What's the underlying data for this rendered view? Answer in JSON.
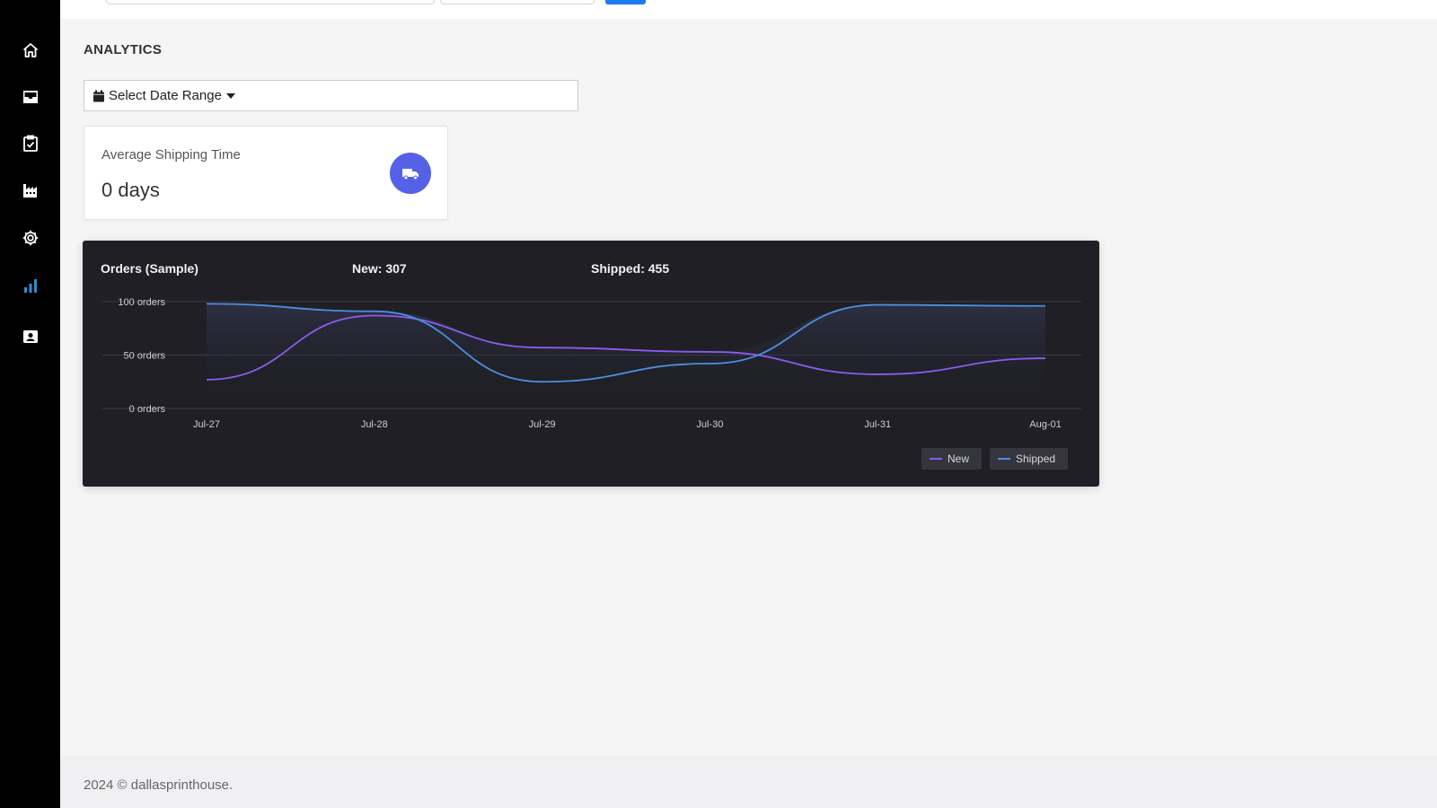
{
  "sidebar": {
    "items": [
      {
        "icon": "home-icon",
        "label": "Home",
        "active": false
      },
      {
        "icon": "inbox-icon",
        "label": "Inbox",
        "active": false
      },
      {
        "icon": "clipboard-check-icon",
        "label": "Tasks",
        "active": false
      },
      {
        "icon": "factory-icon",
        "label": "Production",
        "active": false
      },
      {
        "icon": "gear-icon",
        "label": "Settings",
        "active": false
      },
      {
        "icon": "bar-chart-icon",
        "label": "Analytics",
        "active": true
      },
      {
        "icon": "id-card-icon",
        "label": "Contacts",
        "active": false
      }
    ],
    "active_color": "#2a8fd6"
  },
  "page": {
    "title": "ANALYTICS"
  },
  "date_range": {
    "label": "Select Date Range"
  },
  "stat_card": {
    "label": "Average Shipping Time",
    "value": "0 days",
    "icon": "truck-icon",
    "accent": "#5561e6"
  },
  "chart": {
    "title": "Orders (Sample)",
    "new_total": "New: 307",
    "shipped_total": "Shipped: 455",
    "legend": {
      "new": "New",
      "shipped": "Shipped"
    }
  },
  "chart_data": {
    "type": "line",
    "x": [
      "Jul-27",
      "Jul-28",
      "Jul-29",
      "Jul-30",
      "Jul-31",
      "Aug-01"
    ],
    "series": [
      {
        "name": "New",
        "values": [
          27,
          87,
          57,
          53,
          32,
          47
        ],
        "color": "#8a5cf0"
      },
      {
        "name": "Shipped",
        "values": [
          98,
          91,
          25,
          42,
          97,
          96
        ],
        "color": "#4a8fe0"
      }
    ],
    "y_ticks": [
      "0 orders",
      "50 orders",
      "100 orders"
    ],
    "ylim": [
      0,
      100
    ],
    "grid": true,
    "legend_position": "bottom-right"
  },
  "footer": {
    "text": "2024 © dallasprinthouse."
  }
}
